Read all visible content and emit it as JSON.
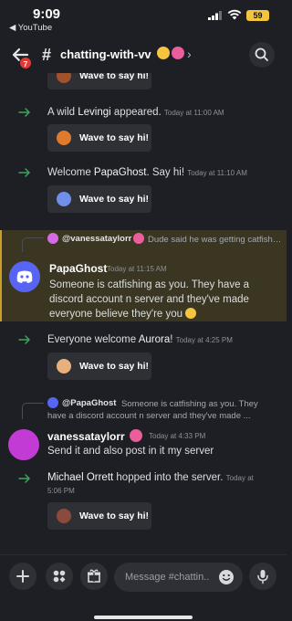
{
  "status": {
    "time": "9:09",
    "back_app": "◀ YouTube",
    "battery": "59"
  },
  "header": {
    "channel": "chatting-with-vv",
    "badge": "7"
  },
  "messages": {
    "top_wave": "Wave to say hi!",
    "levingi": {
      "prefix": "A wild ",
      "name": "Levingi",
      "suffix": " appeared.",
      "stamp": "Today at 11:00 AM",
      "wave": "Wave to say hi!"
    },
    "papaghost_join": {
      "prefix": "Welcome ",
      "name": "PapaGhost",
      "suffix": ". Say hi!",
      "stamp": "Today at 11:10 AM",
      "wave": "Wave to say hi!"
    },
    "highlighted": {
      "reply_name": "@vanessataylorr",
      "reply_text": "Dude said he was getting catfished by someone saying they were from LA lol...",
      "author": "PapaGhost",
      "stamp": "Today at 11:15 AM",
      "body": "Someone is catfishing as you. They have a discord account n server and they've made everyone believe they're you"
    },
    "aurora": {
      "prefix": "Everyone welcome ",
      "name": "Aurora",
      "suffix": "!",
      "stamp": "Today at 4:25 PM",
      "wave": "Wave to say hi!"
    },
    "vanessa": {
      "reply_name": "@PapaGhost",
      "reply_text_1": "Someone is catfishing as you. They",
      "reply_text_2": "have a discord account n server and they've made ...",
      "author": "vanessataylorr",
      "stamp": "Today at 4:33 PM",
      "body": "Send it and also post in it my server"
    },
    "michael": {
      "name": "Michael Orrett",
      "suffix": " hopped into the server.",
      "stamp_1": "Today at",
      "stamp_2": "5:06 PM",
      "wave": "Wave to say hi!"
    }
  },
  "composer": {
    "placeholder": "Message #chattin.."
  },
  "colors": {
    "accent_green": "#3ba55c",
    "highlight_bg": "#3b3622",
    "highlight_border": "#c99f2a",
    "discord_blurple": "#5865f2"
  }
}
